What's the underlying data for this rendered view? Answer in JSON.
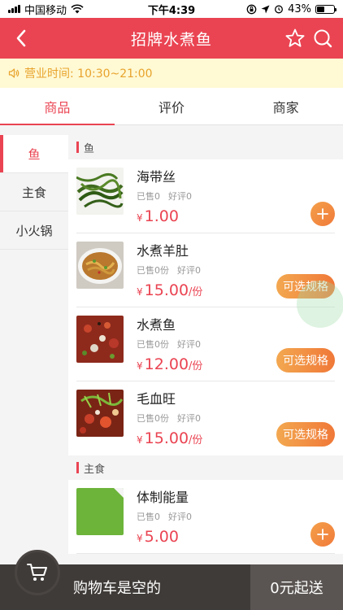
{
  "status_bar": {
    "carrier": "中国移动",
    "time": "下午4:39",
    "battery": "43%",
    "battery_level": 0.43
  },
  "nav": {
    "title": "招牌水煮鱼",
    "back_icon": "chevron-left-icon",
    "favorite_icon": "star-icon",
    "search_icon": "search-icon"
  },
  "notice": {
    "text": "营业时间: 10:30~21:00",
    "icon": "speaker-icon"
  },
  "tabs": [
    {
      "label": "商品",
      "active": true
    },
    {
      "label": "评价",
      "active": false
    },
    {
      "label": "商家",
      "active": false
    }
  ],
  "sidebar": {
    "items": [
      {
        "label": "鱼",
        "active": true
      },
      {
        "label": "主食",
        "active": false
      },
      {
        "label": "小火锅",
        "active": false
      }
    ]
  },
  "sections": [
    {
      "title": "鱼",
      "items": [
        {
          "name": "海带丝",
          "sold": "已售0",
          "rating": "好评0",
          "yen": "¥",
          "price": "1.00",
          "unit": "",
          "action": "add"
        },
        {
          "name": "水煮羊肚",
          "sold": "已售0份",
          "rating": "好评0",
          "yen": "¥",
          "price": "15.00",
          "unit": "/份",
          "action": "可选规格"
        },
        {
          "name": "水煮鱼",
          "sold": "已售0份",
          "rating": "好评0",
          "yen": "¥",
          "price": "12.00",
          "unit": "/份",
          "action": "可选规格"
        },
        {
          "name": "毛血旺",
          "sold": "已售0份",
          "rating": "好评0",
          "yen": "¥",
          "price": "15.00",
          "unit": "/份",
          "action": "可选规格"
        }
      ]
    },
    {
      "title": "主食",
      "items": [
        {
          "name": "体制能量",
          "sold": "已售0",
          "rating": "好评0",
          "yen": "¥",
          "price": "5.00",
          "unit": "",
          "action": "add"
        }
      ]
    }
  ],
  "cart": {
    "empty_text": "购物车是空的",
    "minimum": "0元起送",
    "icon": "cart-icon"
  },
  "colors": {
    "brand": "#ea4452",
    "accent_orange": "#f07838",
    "notice_text": "#e8a32c",
    "cart_bg": "#3f3b38"
  }
}
